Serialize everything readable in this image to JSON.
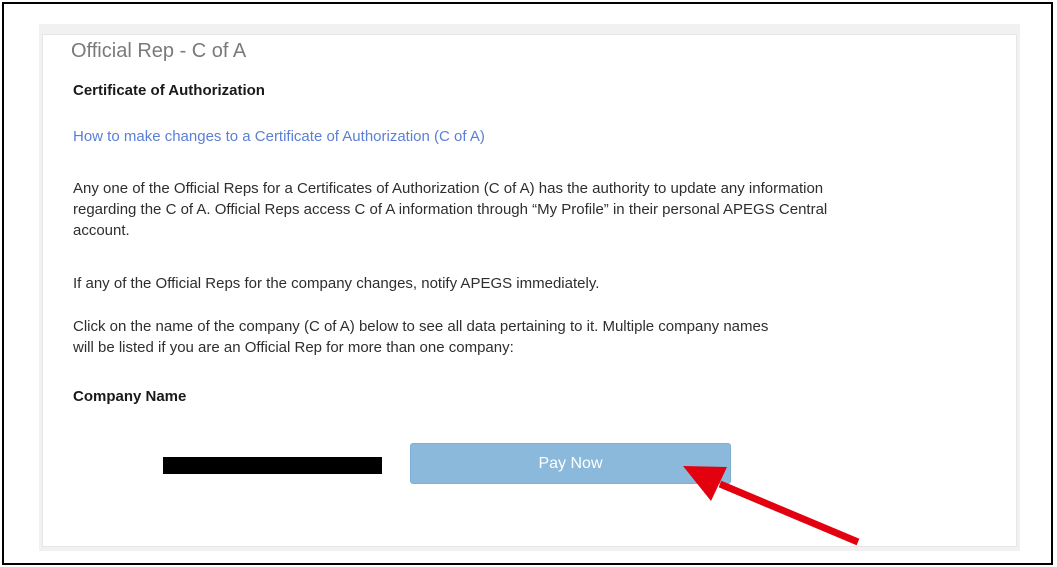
{
  "panel": {
    "title": "Official Rep - C of A",
    "subheading": "Certificate of Authorization",
    "help_link": "How to make changes to a Certificate of Authorization (C of A)",
    "paragraphs": [
      "Any one of the Official Reps for a Certificates of Authorization (C of A) has the authority to update any information regarding the C of A. Official Reps access C of A information through “My Profile” in their personal APEGS Central account.",
      "If any of the Official Reps for the company changes, notify APEGS immediately.",
      "Click on the name of the company (C of A) below to see all data pertaining to it. Multiple company names will be listed if you are an Official Rep for more than one company:"
    ],
    "column_header": "Company Name"
  },
  "companies": [
    {
      "name_redacted": true,
      "action_label": "Pay Now"
    }
  ],
  "annotation": {
    "arrow_color": "#e3000f",
    "target": "pay-now-button"
  },
  "colors": {
    "link": "#5a7fd6",
    "button_bg": "#8ab9db",
    "title": "#7a7a7a",
    "panel_bg": "#f1f1f1"
  }
}
